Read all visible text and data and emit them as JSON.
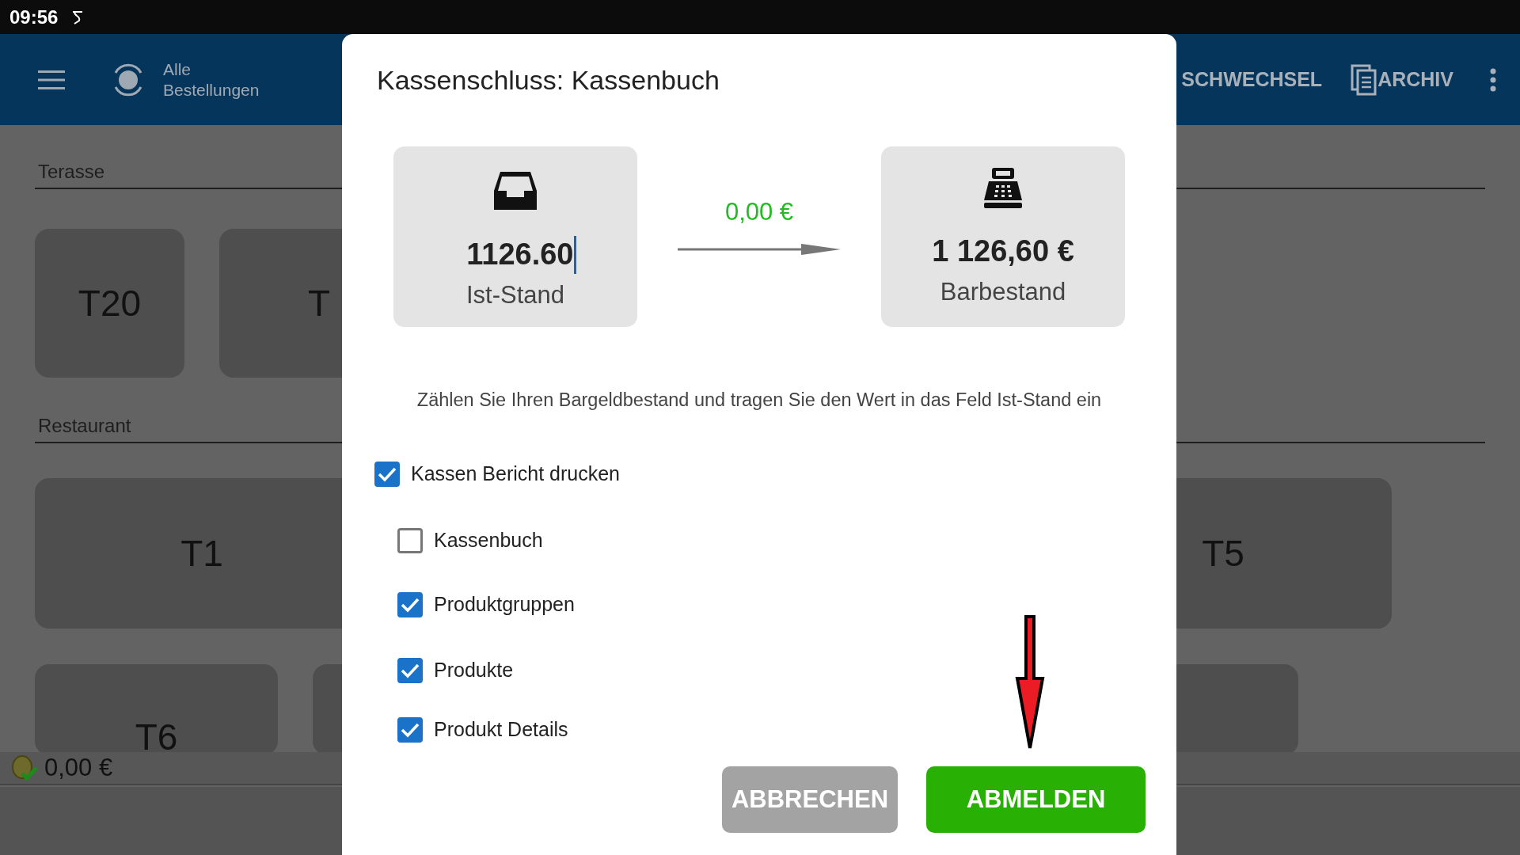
{
  "status_bar": {
    "time": "09:56"
  },
  "app_bar": {
    "title_lines": [
      "Alle",
      "Bestellungen"
    ],
    "actions": [
      {
        "label": "SCHWECHSEL",
        "kind": "text"
      },
      {
        "label": "ARCHIV",
        "kind": "icon-text"
      }
    ]
  },
  "sections": [
    {
      "title": "Terasse",
      "tables": [
        {
          "label": "T20"
        },
        {
          "label": "T"
        }
      ]
    },
    {
      "title": "Restaurant",
      "tables": [
        {
          "label": "T1"
        },
        {
          "label": "T5"
        }
      ]
    },
    {
      "tables": [
        {
          "label": "T6"
        }
      ]
    }
  ],
  "footer": {
    "balance": "0,00 €"
  },
  "dialog": {
    "title": "Kassenschluss: Kassenbuch",
    "ist_stand": {
      "value": "1126.60",
      "label": "Ist-Stand"
    },
    "difference": "0,00 €",
    "barbestand": {
      "value": "1 126,60 €",
      "label": "Barbestand"
    },
    "hint": "Zählen Sie Ihren Bargeldbestand und tragen Sie den Wert in das Feld Ist-Stand ein",
    "options": [
      {
        "label": "Kassen Bericht drucken",
        "checked": true,
        "children": [
          {
            "label": "Kassenbuch",
            "checked": false
          },
          {
            "label": "Produktgruppen",
            "checked": true
          },
          {
            "label": "Produkte",
            "checked": true
          },
          {
            "label": "Produkt Details",
            "checked": true
          }
        ]
      }
    ],
    "buttons": [
      {
        "label": "ABBRECHEN",
        "kind": "cancel"
      },
      {
        "label": "ABMELDEN",
        "kind": "confirm"
      }
    ]
  }
}
